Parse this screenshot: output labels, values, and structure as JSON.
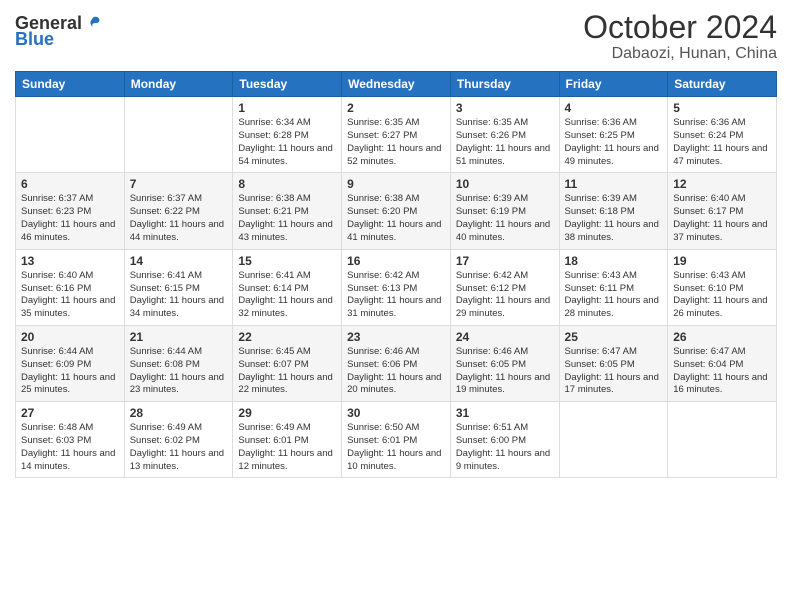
{
  "header": {
    "logo_general": "General",
    "logo_blue": "Blue",
    "title": "October 2024",
    "subtitle": "Dabaozi, Hunan, China"
  },
  "weekdays": [
    "Sunday",
    "Monday",
    "Tuesday",
    "Wednesday",
    "Thursday",
    "Friday",
    "Saturday"
  ],
  "weeks": [
    [
      {
        "day": "",
        "info": ""
      },
      {
        "day": "",
        "info": ""
      },
      {
        "day": "1",
        "info": "Sunrise: 6:34 AM\nSunset: 6:28 PM\nDaylight: 11 hours and 54 minutes."
      },
      {
        "day": "2",
        "info": "Sunrise: 6:35 AM\nSunset: 6:27 PM\nDaylight: 11 hours and 52 minutes."
      },
      {
        "day": "3",
        "info": "Sunrise: 6:35 AM\nSunset: 6:26 PM\nDaylight: 11 hours and 51 minutes."
      },
      {
        "day": "4",
        "info": "Sunrise: 6:36 AM\nSunset: 6:25 PM\nDaylight: 11 hours and 49 minutes."
      },
      {
        "day": "5",
        "info": "Sunrise: 6:36 AM\nSunset: 6:24 PM\nDaylight: 11 hours and 47 minutes."
      }
    ],
    [
      {
        "day": "6",
        "info": "Sunrise: 6:37 AM\nSunset: 6:23 PM\nDaylight: 11 hours and 46 minutes."
      },
      {
        "day": "7",
        "info": "Sunrise: 6:37 AM\nSunset: 6:22 PM\nDaylight: 11 hours and 44 minutes."
      },
      {
        "day": "8",
        "info": "Sunrise: 6:38 AM\nSunset: 6:21 PM\nDaylight: 11 hours and 43 minutes."
      },
      {
        "day": "9",
        "info": "Sunrise: 6:38 AM\nSunset: 6:20 PM\nDaylight: 11 hours and 41 minutes."
      },
      {
        "day": "10",
        "info": "Sunrise: 6:39 AM\nSunset: 6:19 PM\nDaylight: 11 hours and 40 minutes."
      },
      {
        "day": "11",
        "info": "Sunrise: 6:39 AM\nSunset: 6:18 PM\nDaylight: 11 hours and 38 minutes."
      },
      {
        "day": "12",
        "info": "Sunrise: 6:40 AM\nSunset: 6:17 PM\nDaylight: 11 hours and 37 minutes."
      }
    ],
    [
      {
        "day": "13",
        "info": "Sunrise: 6:40 AM\nSunset: 6:16 PM\nDaylight: 11 hours and 35 minutes."
      },
      {
        "day": "14",
        "info": "Sunrise: 6:41 AM\nSunset: 6:15 PM\nDaylight: 11 hours and 34 minutes."
      },
      {
        "day": "15",
        "info": "Sunrise: 6:41 AM\nSunset: 6:14 PM\nDaylight: 11 hours and 32 minutes."
      },
      {
        "day": "16",
        "info": "Sunrise: 6:42 AM\nSunset: 6:13 PM\nDaylight: 11 hours and 31 minutes."
      },
      {
        "day": "17",
        "info": "Sunrise: 6:42 AM\nSunset: 6:12 PM\nDaylight: 11 hours and 29 minutes."
      },
      {
        "day": "18",
        "info": "Sunrise: 6:43 AM\nSunset: 6:11 PM\nDaylight: 11 hours and 28 minutes."
      },
      {
        "day": "19",
        "info": "Sunrise: 6:43 AM\nSunset: 6:10 PM\nDaylight: 11 hours and 26 minutes."
      }
    ],
    [
      {
        "day": "20",
        "info": "Sunrise: 6:44 AM\nSunset: 6:09 PM\nDaylight: 11 hours and 25 minutes."
      },
      {
        "day": "21",
        "info": "Sunrise: 6:44 AM\nSunset: 6:08 PM\nDaylight: 11 hours and 23 minutes."
      },
      {
        "day": "22",
        "info": "Sunrise: 6:45 AM\nSunset: 6:07 PM\nDaylight: 11 hours and 22 minutes."
      },
      {
        "day": "23",
        "info": "Sunrise: 6:46 AM\nSunset: 6:06 PM\nDaylight: 11 hours and 20 minutes."
      },
      {
        "day": "24",
        "info": "Sunrise: 6:46 AM\nSunset: 6:05 PM\nDaylight: 11 hours and 19 minutes."
      },
      {
        "day": "25",
        "info": "Sunrise: 6:47 AM\nSunset: 6:05 PM\nDaylight: 11 hours and 17 minutes."
      },
      {
        "day": "26",
        "info": "Sunrise: 6:47 AM\nSunset: 6:04 PM\nDaylight: 11 hours and 16 minutes."
      }
    ],
    [
      {
        "day": "27",
        "info": "Sunrise: 6:48 AM\nSunset: 6:03 PM\nDaylight: 11 hours and 14 minutes."
      },
      {
        "day": "28",
        "info": "Sunrise: 6:49 AM\nSunset: 6:02 PM\nDaylight: 11 hours and 13 minutes."
      },
      {
        "day": "29",
        "info": "Sunrise: 6:49 AM\nSunset: 6:01 PM\nDaylight: 11 hours and 12 minutes."
      },
      {
        "day": "30",
        "info": "Sunrise: 6:50 AM\nSunset: 6:01 PM\nDaylight: 11 hours and 10 minutes."
      },
      {
        "day": "31",
        "info": "Sunrise: 6:51 AM\nSunset: 6:00 PM\nDaylight: 11 hours and 9 minutes."
      },
      {
        "day": "",
        "info": ""
      },
      {
        "day": "",
        "info": ""
      }
    ]
  ]
}
